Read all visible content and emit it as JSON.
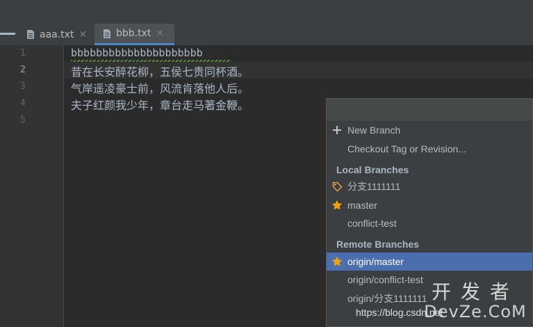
{
  "tabs": [
    {
      "label": "aaa.txt",
      "icon": "text-file-icon",
      "active": false
    },
    {
      "label": "bbb.txt",
      "icon": "text-file-icon",
      "active": true
    }
  ],
  "tab_close_glyph": "✕",
  "gutter": {
    "line_numbers": [
      "1",
      "2",
      "3",
      "4",
      "5"
    ],
    "current_line": "2"
  },
  "editor": {
    "lines": [
      "bbbbbbbbbbbbbbbbbbbbb",
      "昔在长安醉花柳，五侯七贵同杯酒。",
      "气岸遥凌豪士前，风流肯落他人后。",
      "夫子红颜我少年，章台走马著金鞭。",
      ""
    ]
  },
  "branch_popup": {
    "actions": [
      {
        "label": "New Branch",
        "icon": "plus-icon"
      },
      {
        "label": "Checkout Tag or Revision...",
        "icon": ""
      }
    ],
    "local_header": "Local Branches",
    "local_branches": [
      {
        "label": "分支1111111",
        "icon": "tag-icon"
      },
      {
        "label": "master",
        "icon": "star-icon"
      },
      {
        "label": "conflict-test",
        "icon": ""
      }
    ],
    "remote_header": "Remote Branches",
    "remote_branches": [
      {
        "label": "origin/master",
        "icon": "star-icon",
        "selected": true
      },
      {
        "label": "origin/conflict-test",
        "icon": ""
      },
      {
        "label": "origin/分支1111111",
        "icon": ""
      }
    ]
  },
  "watermark": {
    "chinese": "开发者",
    "brand": "DevZe.CoM",
    "url": "https://blog.csdn.net"
  },
  "colors": {
    "accent": "#4a88c7",
    "selection": "#4b6eaf",
    "star": "#f0a30a",
    "tag": "#e6a23c"
  }
}
